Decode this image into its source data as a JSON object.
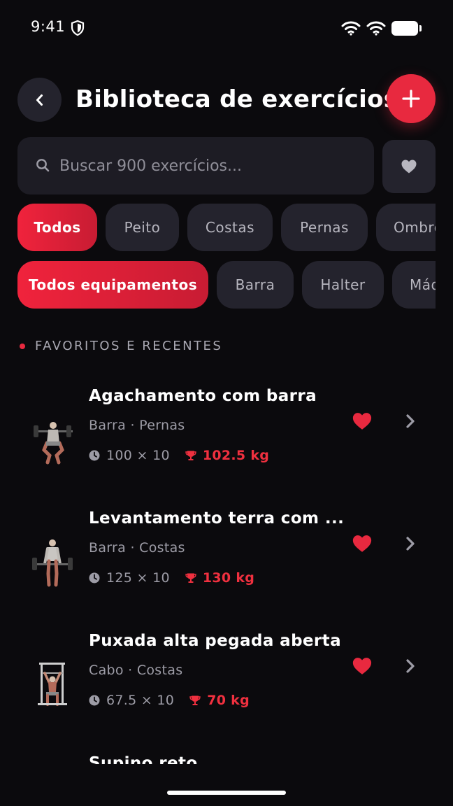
{
  "status_bar": {
    "time": "9:41"
  },
  "header": {
    "title": "Biblioteca de exercícios"
  },
  "search": {
    "placeholder": "Buscar 900 exercícios..."
  },
  "muscle_filters": [
    "Todos",
    "Peito",
    "Costas",
    "Pernas",
    "Ombros"
  ],
  "equipment_filters": [
    "Todos equipamentos",
    "Barra",
    "Halter",
    "Máquina"
  ],
  "section": {
    "title": "FAVORITOS E RECENTES"
  },
  "exercises": [
    {
      "name": "Agachamento com barra",
      "meta": "Barra · Pernas",
      "last_set": "100 × 10",
      "pr": "102.5 kg",
      "favorite": true
    },
    {
      "name": "Levantamento terra com ...",
      "meta": "Barra · Costas",
      "last_set": "125 × 10",
      "pr": "130 kg",
      "favorite": true
    },
    {
      "name": "Puxada alta pegada aberta",
      "meta": "Cabo · Costas",
      "last_set": "67.5 × 10",
      "pr": "70 kg",
      "favorite": true
    },
    {
      "name": "Supino reto"
    }
  ],
  "colors": {
    "accent": "#e8293f",
    "background": "#0b0a0d",
    "surface": "#24232d"
  }
}
